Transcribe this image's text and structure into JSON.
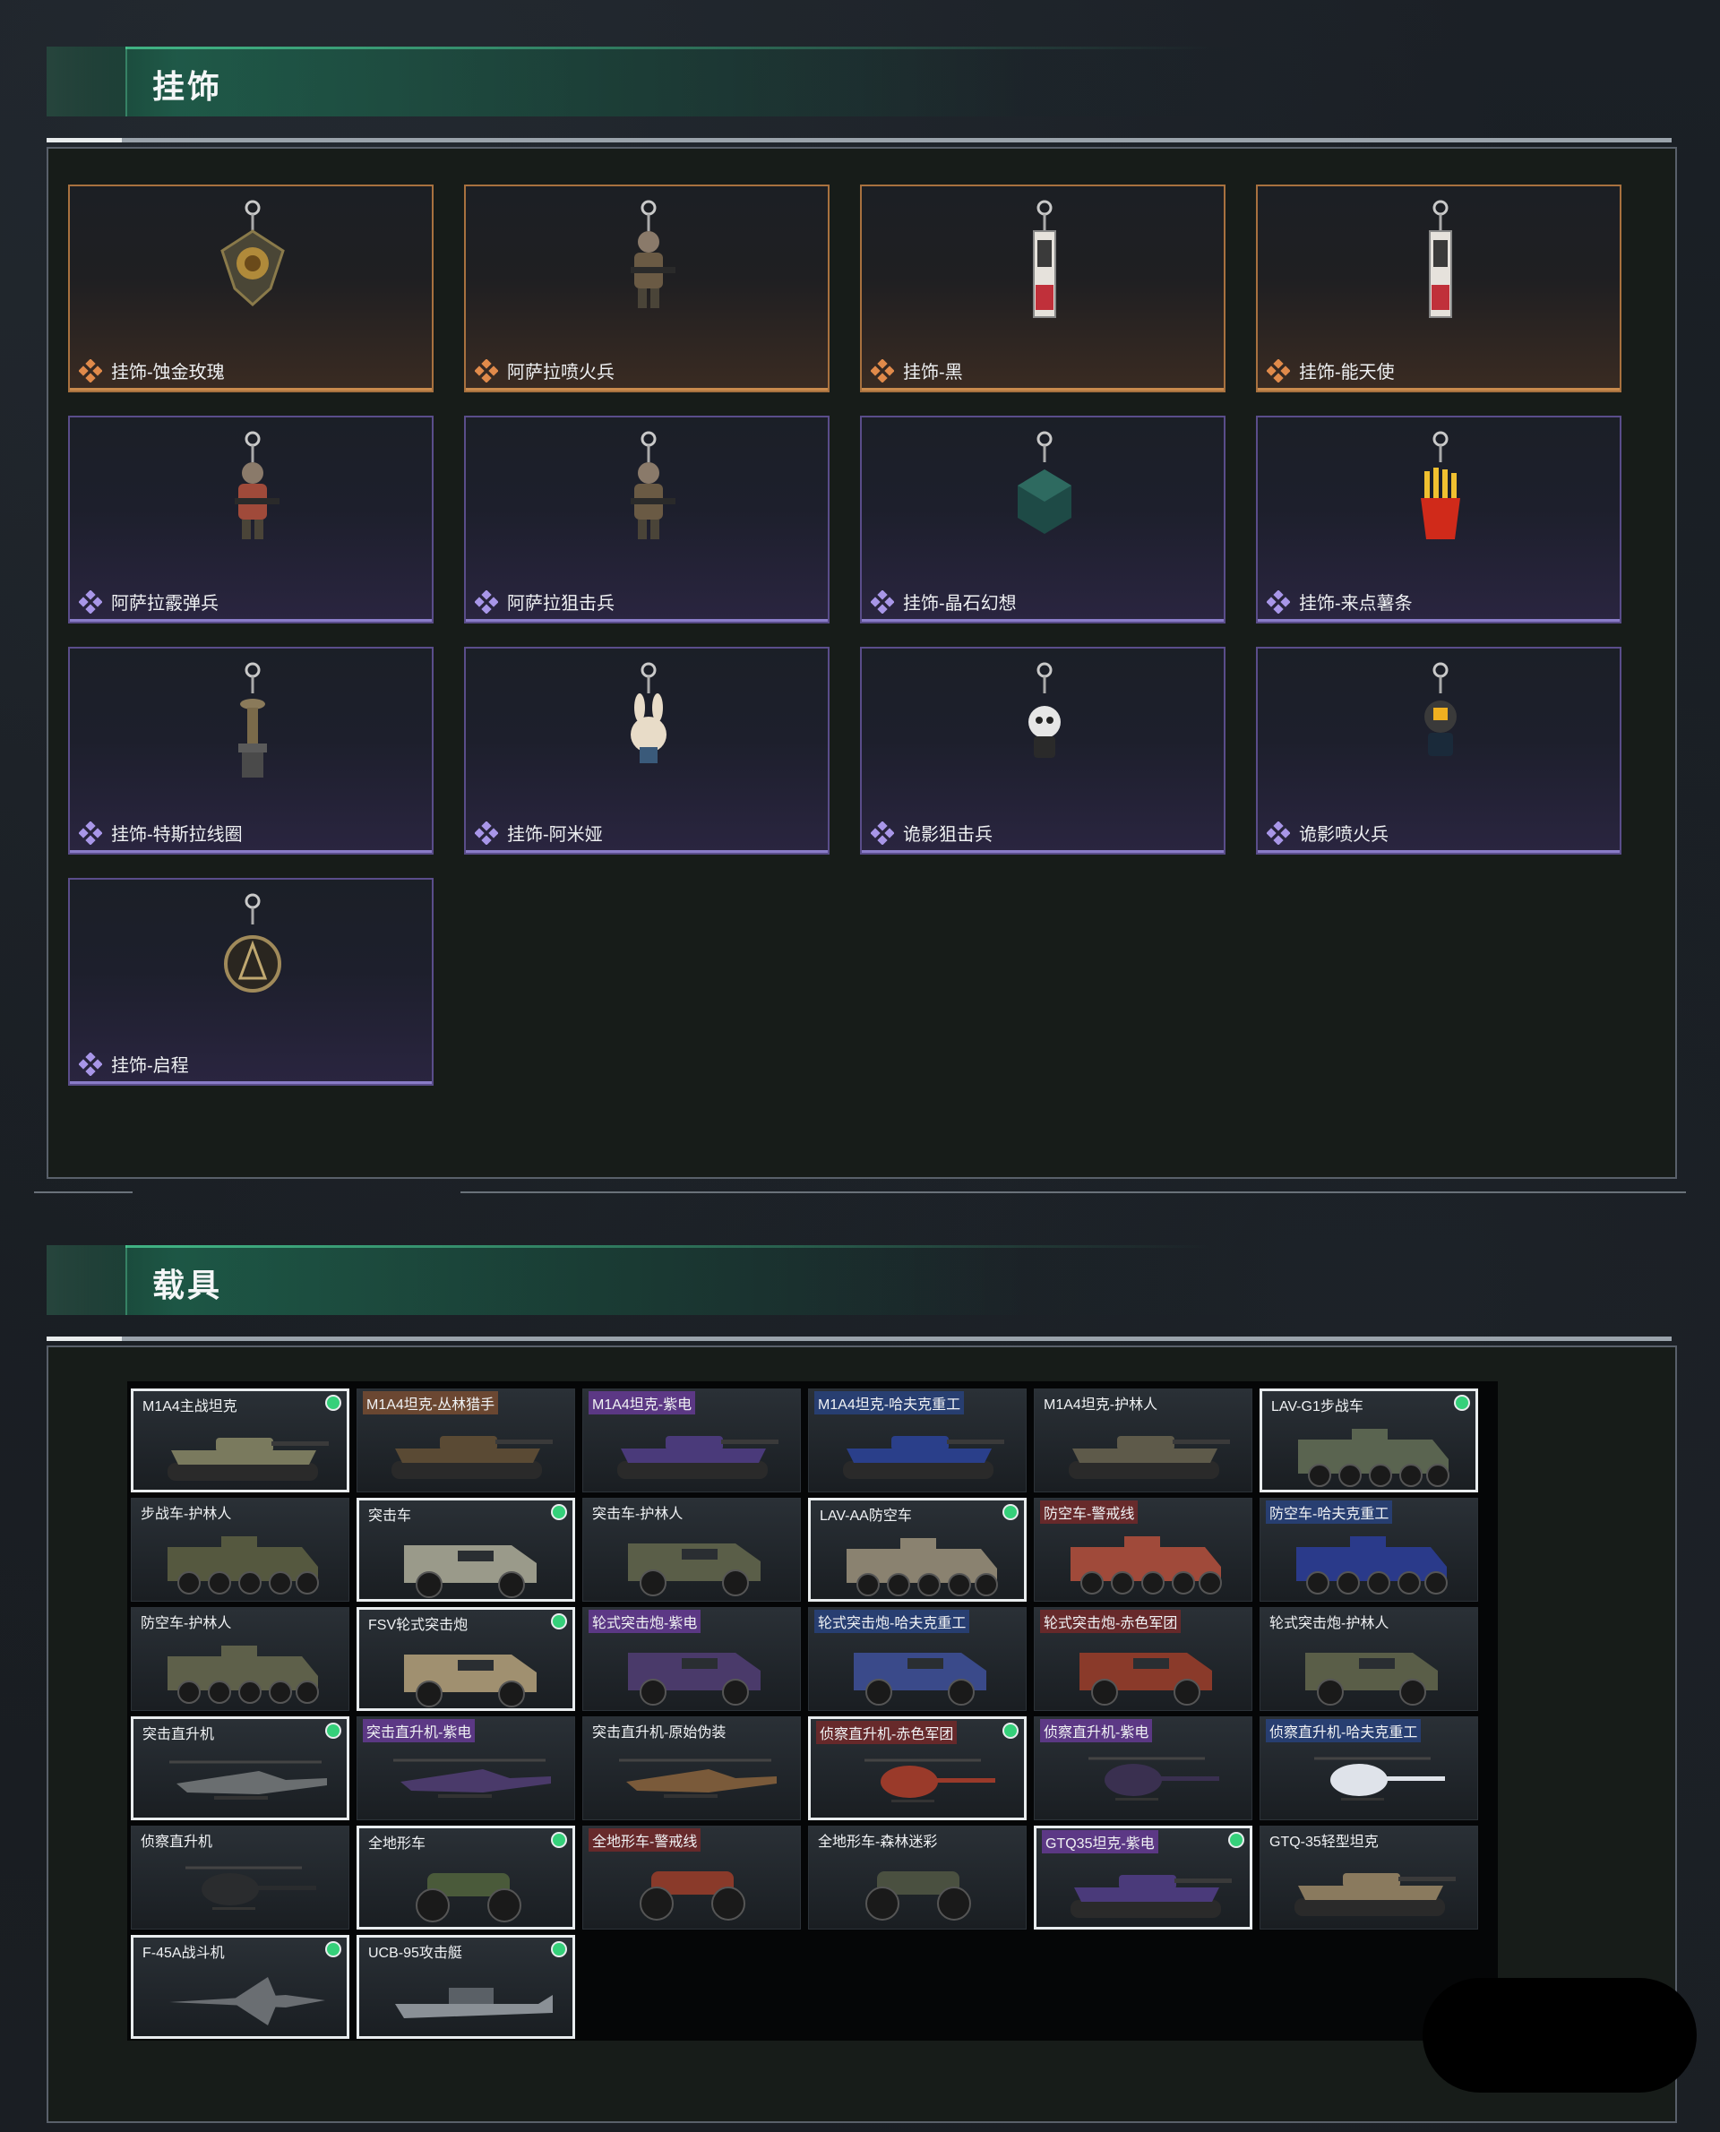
{
  "sections": {
    "charms": {
      "title": "挂饰"
    },
    "vehicles": {
      "title": "载具"
    }
  },
  "colors": {
    "accent_green": "#2fd07a",
    "tier_orange": "#c98a4d",
    "tier_purple": "#8a7cc8",
    "owned_border": "#e8ecee"
  },
  "charms": [
    {
      "name": "挂饰-蚀金玫瑰",
      "tier": "orange",
      "icon": "gold-rose-medallion-charm"
    },
    {
      "name": "阿萨拉喷火兵",
      "tier": "orange",
      "icon": "flamethrower-soldier-charm"
    },
    {
      "name": "挂饰-黑",
      "tier": "orange",
      "icon": "black-tag-charm"
    },
    {
      "name": "挂饰-能天使",
      "tier": "orange",
      "icon": "exusiai-tag-charm"
    },
    {
      "name": "阿萨拉霰弹兵",
      "tier": "purple",
      "icon": "shotgunner-soldier-charm"
    },
    {
      "name": "阿萨拉狙击兵",
      "tier": "purple",
      "icon": "sniper-soldier-charm"
    },
    {
      "name": "挂饰-晶石幻想",
      "tier": "purple",
      "icon": "crystal-cube-charm"
    },
    {
      "name": "挂饰-来点薯条",
      "tier": "purple",
      "icon": "french-fries-charm"
    },
    {
      "name": "挂饰-特斯拉线圈",
      "tier": "purple",
      "icon": "tesla-coil-charm"
    },
    {
      "name": "挂饰-阿米娅",
      "tier": "purple",
      "icon": "amiya-bunny-charm"
    },
    {
      "name": "诡影狙击兵",
      "tier": "purple",
      "icon": "phantom-sniper-charm"
    },
    {
      "name": "诡影喷火兵",
      "tier": "purple",
      "icon": "phantom-flamer-charm"
    },
    {
      "name": "挂饰-启程",
      "tier": "purple",
      "icon": "departure-emblem-charm"
    }
  ],
  "vehicles": [
    {
      "name": "M1A4主战坦克",
      "owned": true,
      "tag": "plain",
      "kind": "tank",
      "color": "#7a7a5e"
    },
    {
      "name": "M1A4坦克-丛林猎手",
      "owned": false,
      "tag": "brown",
      "kind": "tank",
      "color": "#5a4a34"
    },
    {
      "name": "M1A4坦克-紫电",
      "owned": false,
      "tag": "purple",
      "kind": "tank",
      "color": "#4a3a7a"
    },
    {
      "name": "M1A4坦克-哈夫克重工",
      "owned": false,
      "tag": "blue",
      "kind": "tank",
      "color": "#2a3f8a"
    },
    {
      "name": "M1A4坦克-护林人",
      "owned": false,
      "tag": "plain",
      "kind": "tank",
      "color": "#5e5a4a"
    },
    {
      "name": "LAV-G1步战车",
      "owned": true,
      "tag": "plain",
      "kind": "apc",
      "color": "#5a6450"
    },
    {
      "name": "步战车-护林人",
      "owned": false,
      "tag": "plain",
      "kind": "apc",
      "color": "#55583f"
    },
    {
      "name": "突击车",
      "owned": true,
      "tag": "plain",
      "kind": "truck",
      "color": "#9a9a8a"
    },
    {
      "name": "突击车-护林人",
      "owned": false,
      "tag": "plain",
      "kind": "truck",
      "color": "#5a5e48"
    },
    {
      "name": "LAV-AA防空车",
      "owned": true,
      "tag": "plain",
      "kind": "apc",
      "color": "#8a8270"
    },
    {
      "name": "防空车-警戒线",
      "owned": false,
      "tag": "red",
      "kind": "apc",
      "color": "#a04a3a"
    },
    {
      "name": "防空车-哈夫克重工",
      "owned": false,
      "tag": "blue",
      "kind": "apc",
      "color": "#2a3a8a"
    },
    {
      "name": "防空车-护林人",
      "owned": false,
      "tag": "plain",
      "kind": "apc",
      "color": "#5e604a"
    },
    {
      "name": "FSV轮式突击炮",
      "owned": true,
      "tag": "plain",
      "kind": "truck",
      "color": "#a09070"
    },
    {
      "name": "轮式突击炮-紫电",
      "owned": false,
      "tag": "purple",
      "kind": "truck",
      "color": "#4a3a6a"
    },
    {
      "name": "轮式突击炮-哈夫克重工",
      "owned": false,
      "tag": "blue",
      "kind": "truck",
      "color": "#3a4a8a"
    },
    {
      "name": "轮式突击炮-赤色军团",
      "owned": false,
      "tag": "red",
      "kind": "truck",
      "color": "#8a3a2a"
    },
    {
      "name": "轮式突击炮-护林人",
      "owned": false,
      "tag": "plain",
      "kind": "truck",
      "color": "#5a5e48"
    },
    {
      "name": "突击直升机",
      "owned": true,
      "tag": "plain",
      "kind": "heli",
      "color": "#6a6e70"
    },
    {
      "name": "突击直升机-紫电",
      "owned": false,
      "tag": "purple",
      "kind": "heli",
      "color": "#4a3a6a"
    },
    {
      "name": "突击直升机-原始伪装",
      "owned": false,
      "tag": "plain",
      "kind": "heli",
      "color": "#7a5a3a"
    },
    {
      "name": "侦察直升机-赤色军团",
      "owned": true,
      "tag": "red",
      "kind": "smallheli",
      "color": "#9a3a2a"
    },
    {
      "name": "侦察直升机-紫电",
      "owned": false,
      "tag": "purple",
      "kind": "smallheli",
      "color": "#3a3050"
    },
    {
      "name": "侦察直升机-哈夫克重工",
      "owned": false,
      "tag": "blue",
      "kind": "smallheli",
      "color": "#dfe3ea"
    },
    {
      "name": "侦察直升机",
      "owned": false,
      "tag": "plain",
      "kind": "smallheli",
      "color": "#2a2c2e"
    },
    {
      "name": "全地形车",
      "owned": true,
      "tag": "plain",
      "kind": "atv",
      "color": "#4a5a3a"
    },
    {
      "name": "全地形车-警戒线",
      "owned": false,
      "tag": "red",
      "kind": "atv",
      "color": "#8a3a2a"
    },
    {
      "name": "全地形车-森林迷彩",
      "owned": false,
      "tag": "plain",
      "kind": "atv",
      "color": "#4a5040"
    },
    {
      "name": "GTQ35坦克-紫电",
      "owned": true,
      "tag": "purple",
      "kind": "tank",
      "color": "#4a3a7a"
    },
    {
      "name": "GTQ-35轻型坦克",
      "owned": false,
      "tag": "plain",
      "kind": "tank",
      "color": "#8a7a5e"
    },
    {
      "name": "F-45A战斗机",
      "owned": true,
      "tag": "plain",
      "kind": "jet",
      "color": "#6a6e72"
    },
    {
      "name": "UCB-95攻击艇",
      "owned": true,
      "tag": "plain",
      "kind": "boat",
      "color": "#8a9096"
    }
  ]
}
